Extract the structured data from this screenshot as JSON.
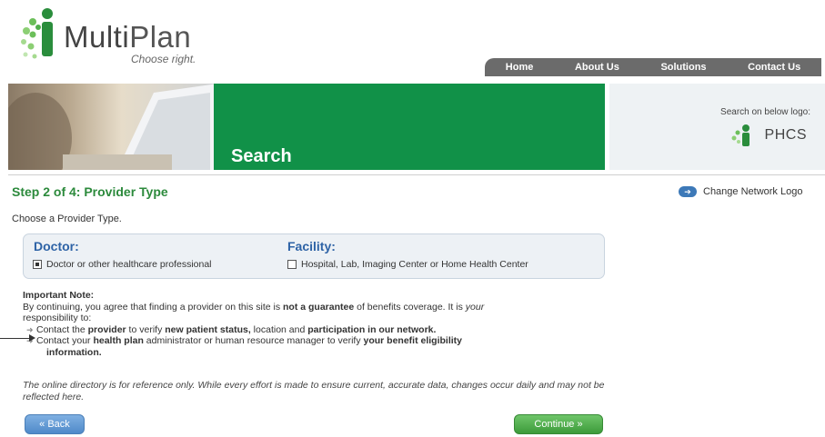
{
  "brand": {
    "name_part1": "Multi",
    "name_part2": "Plan",
    "tagline": "Choose right."
  },
  "nav": {
    "items": [
      "Home",
      "About Us",
      "Solutions",
      "Contact Us"
    ]
  },
  "banner": {
    "title": "Search",
    "search_below": "Search on below logo:",
    "network_logo_text": "PHCS"
  },
  "step": {
    "title": "Step 2 of 4: Provider Type",
    "change_logo": "Change Network Logo",
    "instruction": "Choose a Provider Type."
  },
  "provider_types": {
    "doctor": {
      "label": "Doctor:",
      "option": "Doctor or other healthcare professional",
      "selected": true
    },
    "facility": {
      "label": "Facility:",
      "option": "Hospital, Lab, Imaging Center or Home Health Center",
      "selected": false
    }
  },
  "note": {
    "heading": "Important Note:",
    "intro_1": "By continuing, you agree that finding a provider on this site is ",
    "intro_bold": "not a guarantee",
    "intro_2": " of benefits coverage. It is ",
    "intro_italic": "your",
    "intro_3": "responsibility to:",
    "b1_1": "Contact the ",
    "b1_bold1": "provider",
    "b1_2": " to verify ",
    "b1_bold2": "new patient status,",
    "b1_3": " location and ",
    "b1_bold3": "participation in our network.",
    "b2_1": "Contact your ",
    "b2_bold1": "health plan",
    "b2_2": " administrator or human resource manager to verify ",
    "b2_bold2": "your benefit eligibility",
    "b2_bold3": "information.",
    "disclaimer": "The online directory is for reference only. While every effort is made to ensure current, accurate data, changes occur daily and may not be reflected here."
  },
  "buttons": {
    "back": "« Back",
    "continue": "Continue »"
  },
  "colors": {
    "brand_green": "#119148",
    "step_green": "#2c8a3c",
    "link_blue": "#2e63a6",
    "nav_gray": "#6b6b6b"
  }
}
